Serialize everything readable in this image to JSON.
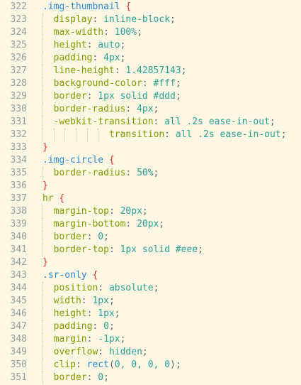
{
  "colors": {
    "background": "#fdf6e3",
    "line_number": "#93a1a1",
    "selector": "#268bd2",
    "tag_selector": "#859900",
    "brace": "#dc322f",
    "property": "#859900",
    "punctuation": "#586e75",
    "value": "#2aa198",
    "function": "#268bd2"
  },
  "lines": [
    {
      "n": "322",
      "indent": 0,
      "tokens": [
        {
          "t": ".img-thumbnail",
          "k": "selector"
        },
        {
          "t": " ",
          "k": "punct"
        },
        {
          "t": "{",
          "k": "brace"
        }
      ]
    },
    {
      "n": "323",
      "indent": 1,
      "tokens": [
        {
          "t": "display",
          "k": "prop"
        },
        {
          "t": ": ",
          "k": "punct"
        },
        {
          "t": "inline-block",
          "k": "value"
        },
        {
          "t": ";",
          "k": "punct"
        }
      ]
    },
    {
      "n": "324",
      "indent": 1,
      "tokens": [
        {
          "t": "max-width",
          "k": "prop"
        },
        {
          "t": ": ",
          "k": "punct"
        },
        {
          "t": "100%",
          "k": "value"
        },
        {
          "t": ";",
          "k": "punct"
        }
      ]
    },
    {
      "n": "325",
      "indent": 1,
      "tokens": [
        {
          "t": "height",
          "k": "prop"
        },
        {
          "t": ": ",
          "k": "punct"
        },
        {
          "t": "auto",
          "k": "value"
        },
        {
          "t": ";",
          "k": "punct"
        }
      ]
    },
    {
      "n": "326",
      "indent": 1,
      "tokens": [
        {
          "t": "padding",
          "k": "prop"
        },
        {
          "t": ": ",
          "k": "punct"
        },
        {
          "t": "4px",
          "k": "value"
        },
        {
          "t": ";",
          "k": "punct"
        }
      ]
    },
    {
      "n": "327",
      "indent": 1,
      "tokens": [
        {
          "t": "line-height",
          "k": "prop"
        },
        {
          "t": ": ",
          "k": "punct"
        },
        {
          "t": "1.42857143",
          "k": "value"
        },
        {
          "t": ";",
          "k": "punct"
        }
      ]
    },
    {
      "n": "328",
      "indent": 1,
      "tokens": [
        {
          "t": "background-color",
          "k": "prop"
        },
        {
          "t": ": ",
          "k": "punct"
        },
        {
          "t": "#fff",
          "k": "value"
        },
        {
          "t": ";",
          "k": "punct"
        }
      ]
    },
    {
      "n": "329",
      "indent": 1,
      "tokens": [
        {
          "t": "border",
          "k": "prop"
        },
        {
          "t": ": ",
          "k": "punct"
        },
        {
          "t": "1px solid #ddd",
          "k": "value"
        },
        {
          "t": ";",
          "k": "punct"
        }
      ]
    },
    {
      "n": "330",
      "indent": 1,
      "tokens": [
        {
          "t": "border-radius",
          "k": "prop"
        },
        {
          "t": ": ",
          "k": "punct"
        },
        {
          "t": "4px",
          "k": "value"
        },
        {
          "t": ";",
          "k": "punct"
        }
      ]
    },
    {
      "n": "331",
      "indent": 1,
      "tokens": [
        {
          "t": "-webkit-transition",
          "k": "prop"
        },
        {
          "t": ": ",
          "k": "punct"
        },
        {
          "t": "all .2s ease-in-out",
          "k": "value"
        },
        {
          "t": ";",
          "k": "punct"
        }
      ]
    },
    {
      "n": "332",
      "indent": 6,
      "tokens": [
        {
          "t": "transition",
          "k": "prop"
        },
        {
          "t": ": ",
          "k": "punct"
        },
        {
          "t": "all .2s ease-in-out",
          "k": "value"
        },
        {
          "t": ";",
          "k": "punct"
        }
      ]
    },
    {
      "n": "333",
      "indent": 0,
      "tokens": [
        {
          "t": "}",
          "k": "brace"
        }
      ]
    },
    {
      "n": "334",
      "indent": 0,
      "tokens": [
        {
          "t": ".img-circle",
          "k": "selector"
        },
        {
          "t": " ",
          "k": "punct"
        },
        {
          "t": "{",
          "k": "brace"
        }
      ]
    },
    {
      "n": "335",
      "indent": 1,
      "tokens": [
        {
          "t": "border-radius",
          "k": "prop"
        },
        {
          "t": ": ",
          "k": "punct"
        },
        {
          "t": "50%",
          "k": "value"
        },
        {
          "t": ";",
          "k": "punct"
        }
      ]
    },
    {
      "n": "336",
      "indent": 0,
      "tokens": [
        {
          "t": "}",
          "k": "brace"
        }
      ]
    },
    {
      "n": "337",
      "indent": 0,
      "tokens": [
        {
          "t": "hr",
          "k": "tag"
        },
        {
          "t": " ",
          "k": "punct"
        },
        {
          "t": "{",
          "k": "brace"
        }
      ]
    },
    {
      "n": "338",
      "indent": 1,
      "tokens": [
        {
          "t": "margin-top",
          "k": "prop"
        },
        {
          "t": ": ",
          "k": "punct"
        },
        {
          "t": "20px",
          "k": "value"
        },
        {
          "t": ";",
          "k": "punct"
        }
      ]
    },
    {
      "n": "339",
      "indent": 1,
      "tokens": [
        {
          "t": "margin-bottom",
          "k": "prop"
        },
        {
          "t": ": ",
          "k": "punct"
        },
        {
          "t": "20px",
          "k": "value"
        },
        {
          "t": ";",
          "k": "punct"
        }
      ]
    },
    {
      "n": "340",
      "indent": 1,
      "tokens": [
        {
          "t": "border",
          "k": "prop"
        },
        {
          "t": ": ",
          "k": "punct"
        },
        {
          "t": "0",
          "k": "value"
        },
        {
          "t": ";",
          "k": "punct"
        }
      ]
    },
    {
      "n": "341",
      "indent": 1,
      "tokens": [
        {
          "t": "border-top",
          "k": "prop"
        },
        {
          "t": ": ",
          "k": "punct"
        },
        {
          "t": "1px solid #eee",
          "k": "value"
        },
        {
          "t": ";",
          "k": "punct"
        }
      ]
    },
    {
      "n": "342",
      "indent": 0,
      "tokens": [
        {
          "t": "}",
          "k": "brace"
        }
      ]
    },
    {
      "n": "343",
      "indent": 0,
      "tokens": [
        {
          "t": ".sr-only",
          "k": "selector"
        },
        {
          "t": " ",
          "k": "punct"
        },
        {
          "t": "{",
          "k": "brace"
        }
      ]
    },
    {
      "n": "344",
      "indent": 1,
      "tokens": [
        {
          "t": "position",
          "k": "prop"
        },
        {
          "t": ": ",
          "k": "punct"
        },
        {
          "t": "absolute",
          "k": "value"
        },
        {
          "t": ";",
          "k": "punct"
        }
      ]
    },
    {
      "n": "345",
      "indent": 1,
      "tokens": [
        {
          "t": "width",
          "k": "prop"
        },
        {
          "t": ": ",
          "k": "punct"
        },
        {
          "t": "1px",
          "k": "value"
        },
        {
          "t": ";",
          "k": "punct"
        }
      ]
    },
    {
      "n": "346",
      "indent": 1,
      "tokens": [
        {
          "t": "height",
          "k": "prop"
        },
        {
          "t": ": ",
          "k": "punct"
        },
        {
          "t": "1px",
          "k": "value"
        },
        {
          "t": ";",
          "k": "punct"
        }
      ]
    },
    {
      "n": "347",
      "indent": 1,
      "tokens": [
        {
          "t": "padding",
          "k": "prop"
        },
        {
          "t": ": ",
          "k": "punct"
        },
        {
          "t": "0",
          "k": "value"
        },
        {
          "t": ";",
          "k": "punct"
        }
      ]
    },
    {
      "n": "348",
      "indent": 1,
      "tokens": [
        {
          "t": "margin",
          "k": "prop"
        },
        {
          "t": ": ",
          "k": "punct"
        },
        {
          "t": "-1px",
          "k": "value"
        },
        {
          "t": ";",
          "k": "punct"
        }
      ]
    },
    {
      "n": "349",
      "indent": 1,
      "tokens": [
        {
          "t": "overflow",
          "k": "prop"
        },
        {
          "t": ": ",
          "k": "punct"
        },
        {
          "t": "hidden",
          "k": "value"
        },
        {
          "t": ";",
          "k": "punct"
        }
      ]
    },
    {
      "n": "350",
      "indent": 1,
      "tokens": [
        {
          "t": "clip",
          "k": "prop"
        },
        {
          "t": ": ",
          "k": "punct"
        },
        {
          "t": "rect",
          "k": "func"
        },
        {
          "t": "(",
          "k": "punct"
        },
        {
          "t": "0, 0, 0, 0",
          "k": "value"
        },
        {
          "t": ");",
          "k": "punct"
        }
      ]
    },
    {
      "n": "351",
      "indent": 1,
      "tokens": [
        {
          "t": "border",
          "k": "prop"
        },
        {
          "t": ": ",
          "k": "punct"
        },
        {
          "t": "0",
          "k": "value"
        },
        {
          "t": ";",
          "k": "punct"
        }
      ]
    }
  ]
}
